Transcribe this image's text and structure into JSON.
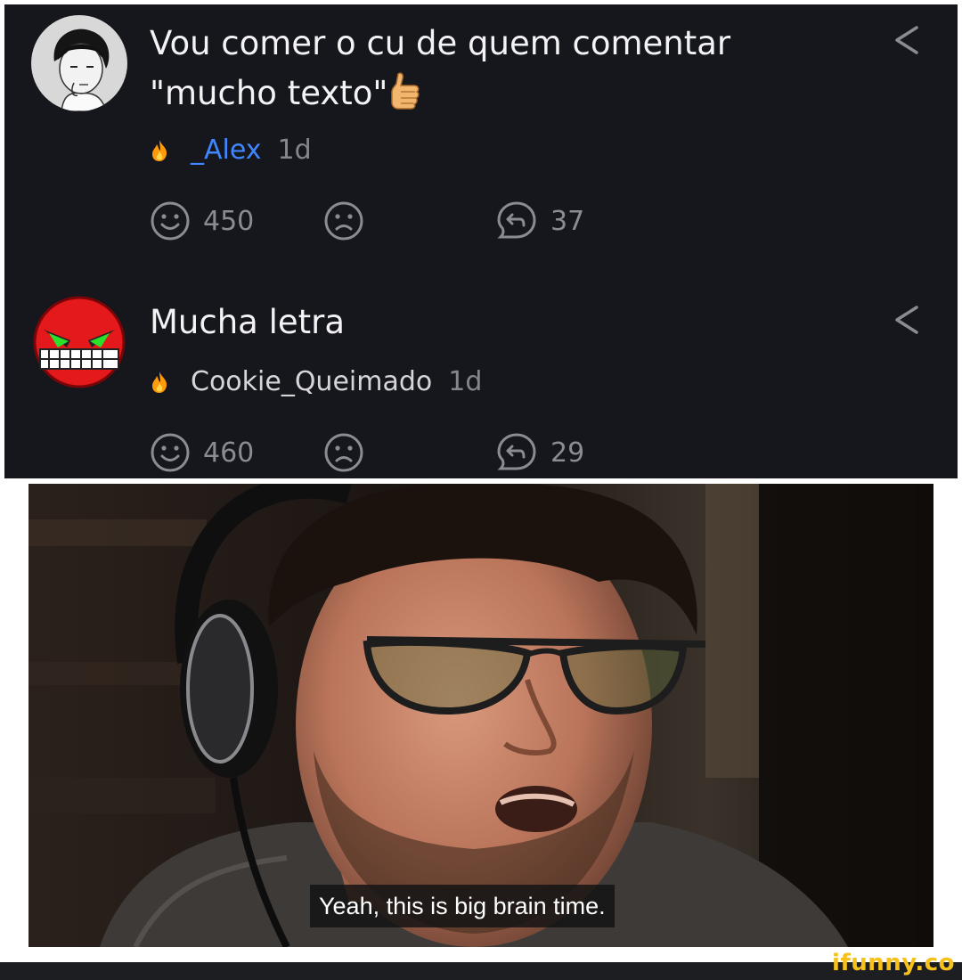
{
  "comments": [
    {
      "lines": [
        "Vou comer o cu de quem comentar",
        "\"mucho texto\""
      ],
      "emoji": "thumbs-up",
      "username": "_Alex",
      "username_color": "#3f86ff",
      "age": "1d",
      "likes": "450",
      "replies": "37"
    },
    {
      "lines": [
        "Mucha letra"
      ],
      "username": "Cookie_Queimado",
      "username_color": "#d6d6da",
      "age": "1d",
      "likes": "460",
      "replies": "29"
    }
  ],
  "icons": {
    "smile": "smile-icon",
    "frown": "frown-icon",
    "reply": "reply-icon",
    "share": "share-icon",
    "fire": "fire-icon"
  },
  "meme": {
    "caption": "Yeah, this is big brain time."
  },
  "footer": {
    "watermark": "ifunny.co",
    "watermark_color": "#f7c11b"
  }
}
